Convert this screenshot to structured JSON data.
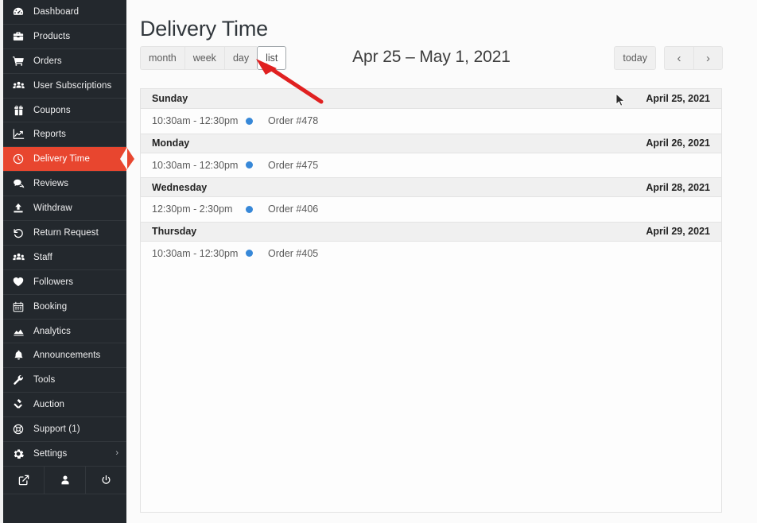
{
  "sidebar": {
    "items": [
      {
        "label": "Dashboard",
        "icon": "dashboard-icon",
        "active": false
      },
      {
        "label": "Products",
        "icon": "products-icon",
        "active": false
      },
      {
        "label": "Orders",
        "icon": "cart-icon",
        "active": false
      },
      {
        "label": "User Subscriptions",
        "icon": "users-icon",
        "active": false
      },
      {
        "label": "Coupons",
        "icon": "gift-icon",
        "active": false
      },
      {
        "label": "Reports",
        "icon": "chart-line-icon",
        "active": false
      },
      {
        "label": "Delivery Time",
        "icon": "clock-icon",
        "active": true
      },
      {
        "label": "Reviews",
        "icon": "comment-icon",
        "active": false
      },
      {
        "label": "Withdraw",
        "icon": "upload-icon",
        "active": false
      },
      {
        "label": "Return Request",
        "icon": "undo-icon",
        "active": false
      },
      {
        "label": "Staff",
        "icon": "users-icon",
        "active": false
      },
      {
        "label": "Followers",
        "icon": "heart-icon",
        "active": false
      },
      {
        "label": "Booking",
        "icon": "calendar-icon",
        "active": false
      },
      {
        "label": "Analytics",
        "icon": "analytics-icon",
        "active": false
      },
      {
        "label": "Announcements",
        "icon": "bell-icon",
        "active": false
      },
      {
        "label": "Tools",
        "icon": "wrench-icon",
        "active": false
      },
      {
        "label": "Auction",
        "icon": "gavel-icon",
        "active": false
      },
      {
        "label": "Support (1)",
        "icon": "lifering-icon",
        "active": false
      },
      {
        "label": "Settings",
        "icon": "gear-icon",
        "active": false,
        "chevron": "›"
      }
    ],
    "bottom_icons": [
      {
        "name": "external-link-icon"
      },
      {
        "name": "user-icon"
      },
      {
        "name": "power-icon"
      }
    ]
  },
  "header": {
    "title": "Delivery Time"
  },
  "toolbar": {
    "views": [
      {
        "label": "month",
        "active": false
      },
      {
        "label": "week",
        "active": false
      },
      {
        "label": "day",
        "active": false
      },
      {
        "label": "list",
        "active": true
      }
    ],
    "range_title": "Apr 25 – May 1, 2021",
    "today_label": "today",
    "prev_label": "‹",
    "next_label": "›"
  },
  "calendar": {
    "days": [
      {
        "weekday": "Sunday",
        "date": "April 25, 2021",
        "events": [
          {
            "time": "10:30am - 12:30pm",
            "title": "Order #478",
            "dot_color": "#3788d8"
          }
        ]
      },
      {
        "weekday": "Monday",
        "date": "April 26, 2021",
        "events": [
          {
            "time": "10:30am - 12:30pm",
            "title": "Order #475",
            "dot_color": "#3788d8"
          }
        ]
      },
      {
        "weekday": "Wednesday",
        "date": "April 28, 2021",
        "events": [
          {
            "time": "12:30pm - 2:30pm",
            "title": "Order #406",
            "dot_color": "#3788d8"
          }
        ]
      },
      {
        "weekday": "Thursday",
        "date": "April 29, 2021",
        "events": [
          {
            "time": "10:30am - 12:30pm",
            "title": "Order #405",
            "dot_color": "#3788d8"
          }
        ]
      }
    ]
  },
  "annotation": {
    "arrow_color": "#e02020",
    "points_at": "list"
  },
  "colors": {
    "sidebar_bg": "#23282d",
    "accent": "#e8462f",
    "event_dot": "#3788d8",
    "page_bg": "#fbfbfb"
  }
}
